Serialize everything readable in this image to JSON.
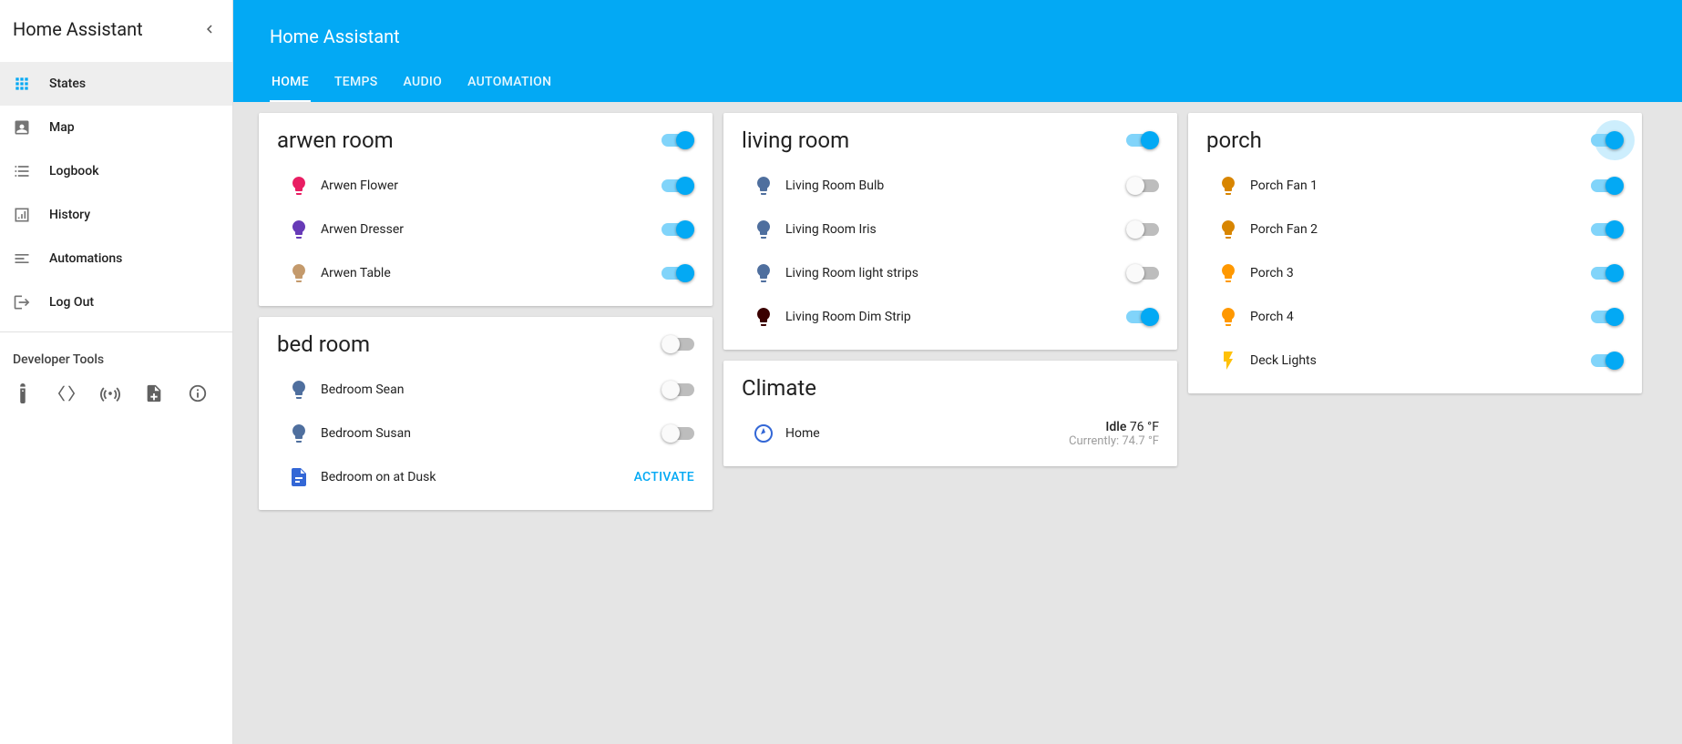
{
  "sidebar": {
    "title": "Home Assistant",
    "items": [
      {
        "id": "states",
        "label": "States",
        "icon": "grid",
        "active": true
      },
      {
        "id": "map",
        "label": "Map",
        "icon": "account-box",
        "active": false
      },
      {
        "id": "logbook",
        "label": "Logbook",
        "icon": "list",
        "active": false
      },
      {
        "id": "history",
        "label": "History",
        "icon": "chart",
        "active": false
      },
      {
        "id": "automations",
        "label": "Automations",
        "icon": "lines",
        "active": false
      },
      {
        "id": "logout",
        "label": "Log Out",
        "icon": "logout",
        "active": false
      }
    ],
    "dev_tools_label": "Developer Tools"
  },
  "header": {
    "title": "Home Assistant",
    "tabs": [
      {
        "id": "home",
        "label": "HOME",
        "active": true
      },
      {
        "id": "temps",
        "label": "TEMPS",
        "active": false
      },
      {
        "id": "audio",
        "label": "AUDIO",
        "active": false
      },
      {
        "id": "automation",
        "label": "AUTOMATION",
        "active": false
      }
    ]
  },
  "cards": {
    "arwen": {
      "title": "arwen room",
      "master_on": true,
      "items": [
        {
          "label": "Arwen Flower",
          "on": true,
          "color": "#e91e63"
        },
        {
          "label": "Arwen Dresser",
          "on": true,
          "color": "#673ab7"
        },
        {
          "label": "Arwen Table",
          "on": true,
          "color": "#c49a6c"
        }
      ]
    },
    "bed": {
      "title": "bed room",
      "master_on": false,
      "items": [
        {
          "label": "Bedroom Sean",
          "on": false,
          "color": "#4f6f9e"
        },
        {
          "label": "Bedroom Susan",
          "on": false,
          "color": "#4f6f9e"
        }
      ],
      "script": {
        "label": "Bedroom on at Dusk",
        "action": "ACTIVATE"
      }
    },
    "living": {
      "title": "living room",
      "master_on": true,
      "items": [
        {
          "label": "Living Room Bulb",
          "on": false,
          "color": "#4f6f9e"
        },
        {
          "label": "Living Room Iris",
          "on": false,
          "color": "#4f6f9e"
        },
        {
          "label": "Living Room light strips",
          "on": false,
          "color": "#4f6f9e"
        },
        {
          "label": "Living Room Dim Strip",
          "on": true,
          "color": "#3a0000"
        }
      ]
    },
    "climate": {
      "title": "Climate",
      "row": {
        "label": "Home",
        "state": "Idle",
        "target": "76 °F",
        "current_prefix": "Currently: ",
        "current": "74.7 °F"
      }
    },
    "porch": {
      "title": "porch",
      "master_on": true,
      "master_glow": true,
      "items": [
        {
          "label": "Porch Fan 1",
          "on": true,
          "color": "#d88500",
          "icon": "bulb"
        },
        {
          "label": "Porch Fan 2",
          "on": true,
          "color": "#d88500",
          "icon": "bulb"
        },
        {
          "label": "Porch 3",
          "on": true,
          "color": "#ff9800",
          "icon": "bulb"
        },
        {
          "label": "Porch 4",
          "on": true,
          "color": "#ff9800",
          "icon": "bulb"
        },
        {
          "label": "Deck Lights",
          "on": true,
          "color": "#ffc107",
          "icon": "flash"
        }
      ]
    }
  }
}
